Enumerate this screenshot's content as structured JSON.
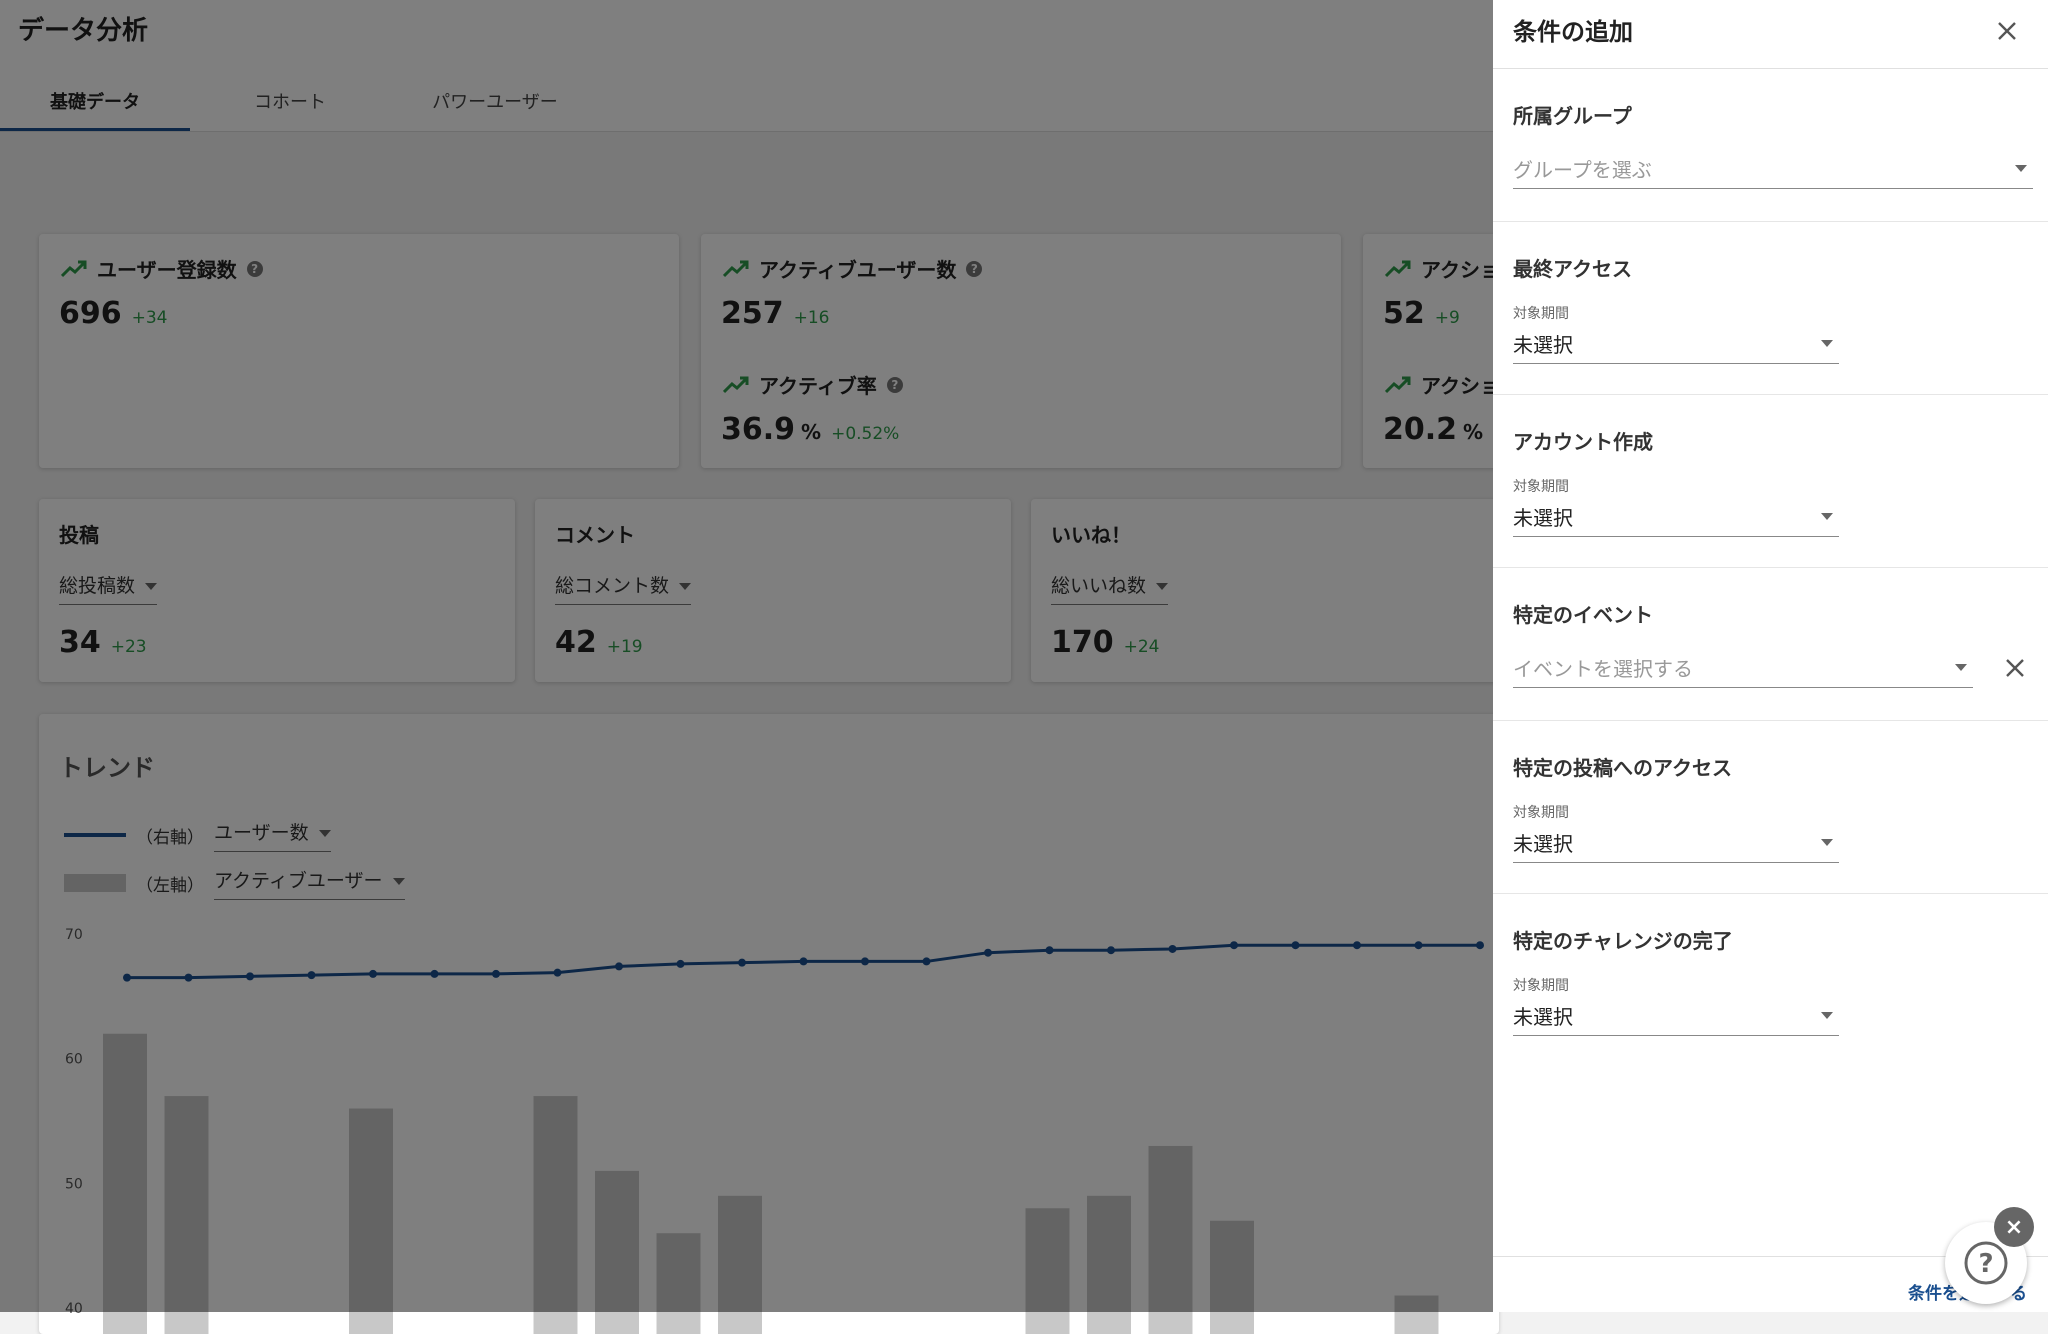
{
  "app": {
    "title": "データ分析"
  },
  "tabs": [
    {
      "label": "基礎データ",
      "active": true
    },
    {
      "label": "コホート",
      "active": false
    },
    {
      "label": "パワーユーザー",
      "active": false
    }
  ],
  "stat_cards": [
    {
      "title": "ユーザー登録数",
      "value": "696",
      "delta": "+34"
    },
    {
      "title": "アクティブユーザー数",
      "value": "257",
      "delta": "+16",
      "sub_title": "アクティブ率",
      "sub_value": "36.9",
      "sub_unit": "%",
      "sub_delta": "+0.52%"
    },
    {
      "title": "アクショ",
      "value": "52",
      "delta": "+9",
      "sub_title": "アクショ",
      "sub_value": "20.2",
      "sub_unit": "%",
      "sub_delta": "+"
    }
  ],
  "mini_cards": [
    {
      "title": "投稿",
      "select": "総投稿数",
      "value": "34",
      "delta": "+23"
    },
    {
      "title": "コメント",
      "select": "総コメント数",
      "value": "42",
      "delta": "+19"
    },
    {
      "title": "いいね！",
      "select": "総いいね数",
      "value": "170",
      "delta": "+24"
    }
  ],
  "trend": {
    "title": "トレンド",
    "legend_line_axis": "（右軸）",
    "legend_line_select": "ユーザー数",
    "legend_bar_axis": "（左軸）",
    "legend_bar_select": "アクティブユーザー",
    "colors": {
      "line": "#1a4f8f",
      "bar": "#c8c8c8"
    }
  },
  "chart_data": {
    "type": "bar",
    "title": "",
    "xlabel": "",
    "ylabel": "",
    "ylim": [
      40,
      70
    ],
    "y_ticks": [
      70,
      60,
      50,
      40
    ],
    "series": [
      {
        "name": "アクティブユーザー",
        "type": "bar",
        "axis": "left",
        "values": [
          62,
          57,
          40,
          40,
          56,
          40,
          40,
          57,
          51,
          46,
          49,
          40,
          40,
          40,
          40,
          48,
          49,
          53,
          47,
          40,
          40,
          41,
          40
        ]
      },
      {
        "name": "ユーザー数",
        "type": "line",
        "axis": "right",
        "values": [
          66.5,
          66.5,
          66.6,
          66.7,
          66.8,
          66.8,
          66.8,
          66.9,
          67.4,
          67.6,
          67.7,
          67.8,
          67.8,
          67.8,
          68.5,
          68.7,
          68.7,
          68.8,
          69.1,
          69.1,
          69.1,
          69.1,
          69.1
        ]
      }
    ]
  },
  "drawer": {
    "title": "条件の追加",
    "sections": [
      {
        "title": "所属グループ",
        "label": "",
        "value": "グループを選ぶ",
        "placeholder": true
      },
      {
        "title": "最終アクセス",
        "label": "対象期間",
        "value": "未選択",
        "placeholder": false
      },
      {
        "title": "アカウント作成",
        "label": "対象期間",
        "value": "未選択",
        "placeholder": false
      },
      {
        "title": "特定のイベント",
        "label": "",
        "value": "イベントを選択する",
        "placeholder": true
      },
      {
        "title": "特定の投稿へのアクセス",
        "label": "対象期間",
        "value": "未選択",
        "placeholder": false
      },
      {
        "title": "特定のチャレンジの完了",
        "label": "対象期間",
        "value": "未選択",
        "placeholder": false
      }
    ],
    "footer_text": "条件を追加する"
  },
  "icons": {
    "trend_up": "trending-up-icon",
    "help": "help-circle-icon",
    "close": "close-icon"
  }
}
